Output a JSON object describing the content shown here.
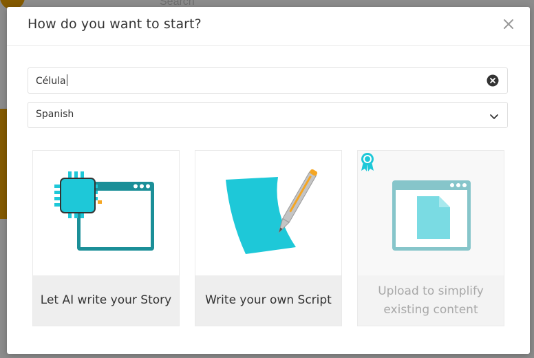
{
  "background": {
    "search_text": "Search"
  },
  "modal": {
    "title": "How do you want to start?",
    "topic_input": {
      "value": "Célula"
    },
    "language_select": {
      "selected": "Spanish"
    },
    "cards": [
      {
        "label": "Let AI write your Story",
        "icon": "ai-chip-window-icon",
        "enabled": true
      },
      {
        "label": "Write your own Script",
        "icon": "paper-pen-icon",
        "enabled": true
      },
      {
        "label": "Upload to simplify existing content",
        "icon": "upload-document-window-icon",
        "enabled": false,
        "badge": "premium-ribbon-icon"
      }
    ]
  },
  "colors": {
    "accent": "#1ec8d8",
    "accent_dark": "#1b8f98",
    "pencil_orange": "#f5a623",
    "muted_accent": "#7fc7cc"
  }
}
